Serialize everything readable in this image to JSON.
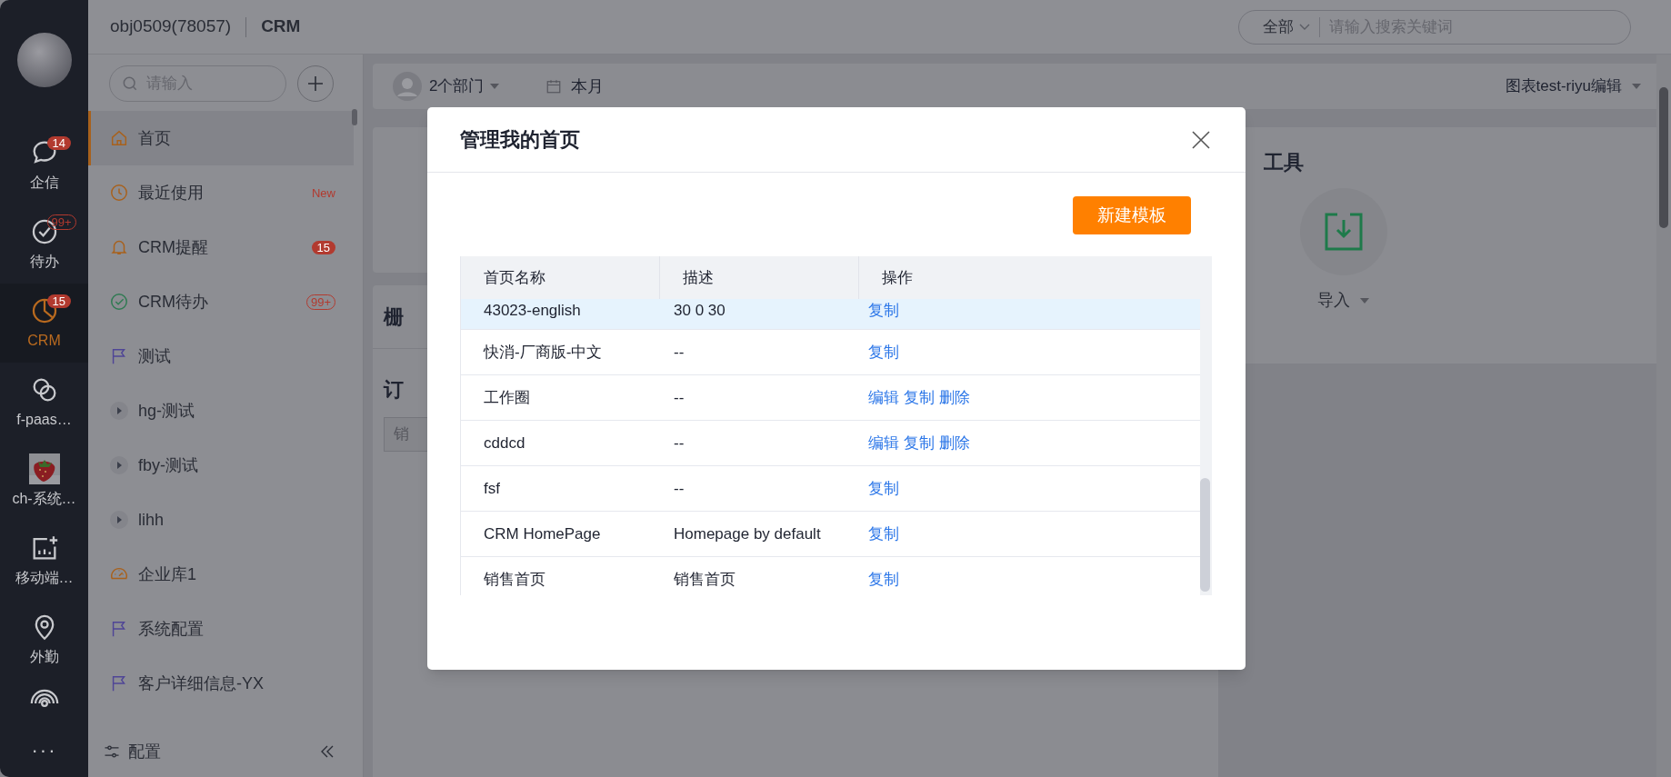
{
  "rail": {
    "items": [
      {
        "label": "企信",
        "selected": false,
        "badge": {
          "text": "14",
          "kind": "filled"
        }
      },
      {
        "label": "待办",
        "selected": false,
        "badge": {
          "text": "99+",
          "kind": "outline"
        }
      },
      {
        "label": "CRM",
        "selected": true,
        "badge": {
          "text": "15",
          "kind": "filled"
        }
      },
      {
        "label": "f-paas…",
        "selected": false
      },
      {
        "label": "ch-系统…",
        "selected": false,
        "kind": "picture"
      },
      {
        "label": "移动端…",
        "selected": false
      },
      {
        "label": "外勤",
        "selected": false
      }
    ],
    "more": "···"
  },
  "header": {
    "org": "obj0509(78057)",
    "app": "CRM",
    "search": {
      "scope": "全部",
      "placeholder": "请输入搜索关键词"
    }
  },
  "sidebar": {
    "search": {
      "placeholder": "请输入"
    },
    "items": [
      {
        "label": "首页",
        "selected": true,
        "kind": "link"
      },
      {
        "label": "最近使用",
        "selected": false,
        "kind": "link",
        "badge": {
          "text": "New",
          "kind": "text"
        }
      },
      {
        "label": "CRM提醒",
        "selected": false,
        "kind": "link",
        "badge": {
          "text": "15",
          "kind": "filled"
        }
      },
      {
        "label": "CRM待办",
        "selected": false,
        "kind": "link",
        "badge": {
          "text": "99+",
          "kind": "outline"
        }
      },
      {
        "label": "测试",
        "selected": false,
        "kind": "link"
      },
      {
        "label": "hg-测试",
        "selected": false,
        "kind": "group"
      },
      {
        "label": "fby-测试",
        "selected": false,
        "kind": "group"
      },
      {
        "label": "lihh",
        "selected": false,
        "kind": "group"
      },
      {
        "label": "企业库1",
        "selected": false,
        "kind": "link"
      },
      {
        "label": "系统配置",
        "selected": false,
        "kind": "link"
      },
      {
        "label": "客户详细信息-YX",
        "selected": false,
        "kind": "link"
      }
    ],
    "footer": {
      "label": "配置"
    }
  },
  "filter_bar": {
    "departments": "2个部门",
    "period": "本月",
    "edit": "图表test-riyu编辑"
  },
  "background_cards": {
    "grid_title": "栅",
    "order_title": "订",
    "order_tab": "销",
    "tools_title": "工具",
    "import": "导入"
  },
  "dialog": {
    "title": "管理我的首页",
    "new_button": "新建模板",
    "table": {
      "columns": [
        "首页名称",
        "描述",
        "操作"
      ],
      "rows": [
        {
          "name": "43023-english",
          "description": "30 0 30",
          "actions": [
            "复制"
          ],
          "highlighted": true
        },
        {
          "name": "快消-厂商版-中文",
          "description": "--",
          "actions": [
            "复制"
          ],
          "highlighted": false
        },
        {
          "name": "工作圈",
          "description": "--",
          "actions": [
            "编辑",
            "复制",
            "删除"
          ],
          "highlighted": false
        },
        {
          "name": "cddcd",
          "description": "--",
          "actions": [
            "编辑",
            "复制",
            "删除"
          ],
          "highlighted": false
        },
        {
          "name": "fsf",
          "description": "--",
          "actions": [
            "复制"
          ],
          "highlighted": false
        },
        {
          "name": "CRM HomePage",
          "description": "Homepage by default",
          "actions": [
            "复制"
          ],
          "highlighted": false
        },
        {
          "name": "销售首页",
          "description": "销售首页",
          "actions": [
            "复制"
          ],
          "highlighted": false
        }
      ]
    }
  }
}
